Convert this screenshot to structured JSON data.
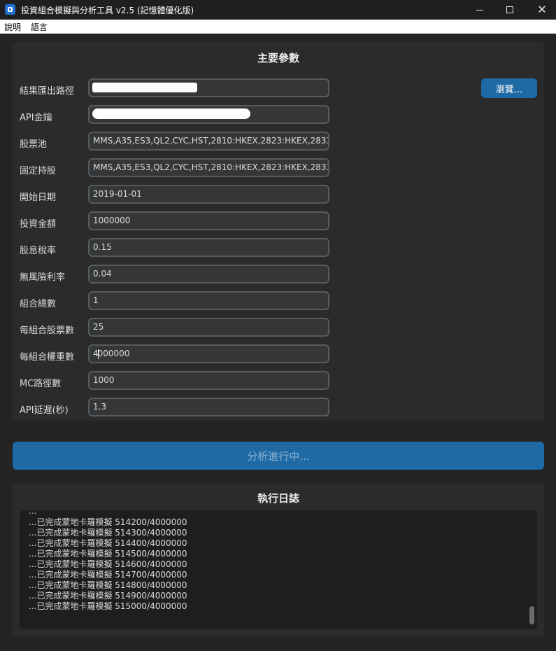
{
  "window": {
    "title": "投資組合模擬與分析工具 v2.5 (記憶體優化版)",
    "controls": {
      "minimize": "—",
      "close": "✕"
    }
  },
  "menu": {
    "items": [
      "說明",
      "語言"
    ]
  },
  "params": {
    "title": "主要參數",
    "browse_label": "瀏覽...",
    "rows": [
      {
        "label": "結果匯出路徑",
        "value": ""
      },
      {
        "label": "API金鑰",
        "value": ""
      },
      {
        "label": "股票池",
        "value": "MMS,A35,ES3,QL2,CYC,HST,2810:HKEX,2823:HKEX,2833:H"
      },
      {
        "label": "固定持股",
        "value": "MMS,A35,ES3,QL2,CYC,HST,2810:HKEX,2823:HKEX,2833:H"
      },
      {
        "label": "開始日期",
        "value": "2019-01-01"
      },
      {
        "label": "投資金額",
        "value": "1000000"
      },
      {
        "label": "股息稅率",
        "value": "0.15"
      },
      {
        "label": "無風險利率",
        "value": "0.04"
      },
      {
        "label": "組合總數",
        "value": "1"
      },
      {
        "label": "每組合股票數",
        "value": "25"
      },
      {
        "label": "每組合權重數",
        "value_prefix": "4",
        "value_suffix": "000000"
      },
      {
        "label": "MC路徑數",
        "value": "1000"
      },
      {
        "label": "API延遲(秒)",
        "value": "1.3"
      }
    ]
  },
  "run_button": {
    "label": "分析進行中..."
  },
  "log": {
    "title": "執行日誌",
    "lines": [
      "...已完成蒙地卡羅模擬 514200/4000000",
      "...已完成蒙地卡羅模擬 514300/4000000",
      "...已完成蒙地卡羅模擬 514400/4000000",
      "...已完成蒙地卡羅模擬 514500/4000000",
      "...已完成蒙地卡羅模擬 514600/4000000",
      "...已完成蒙地卡羅模擬 514700/4000000",
      "...已完成蒙地卡羅模擬 514800/4000000",
      "...已完成蒙地卡羅模擬 514900/4000000",
      "...已完成蒙地卡羅模擬 515000/4000000"
    ]
  },
  "colors": {
    "background": "#242424",
    "panel": "#2b2b2b",
    "accent": "#1f6aa5",
    "input_bg": "#343638",
    "input_border": "#565b5e"
  }
}
